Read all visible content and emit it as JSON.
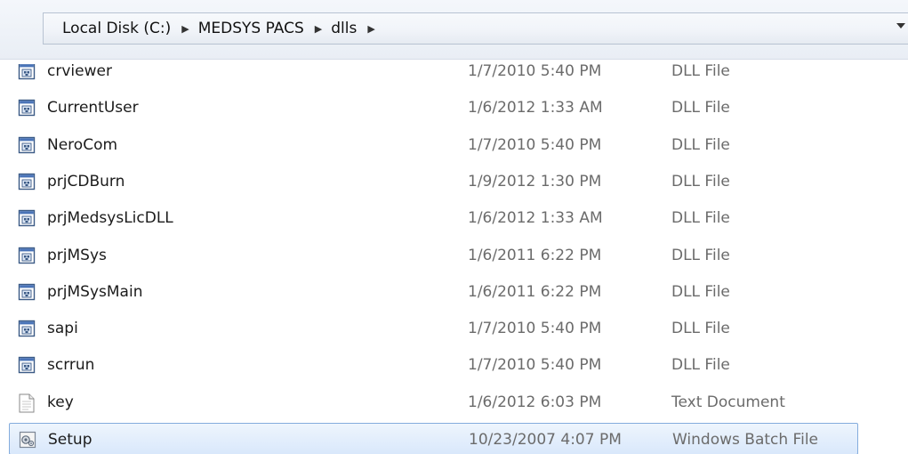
{
  "breadcrumb": {
    "items": [
      "Local Disk (C:)",
      "MEDSYS PACS",
      "dlls"
    ]
  },
  "files": [
    {
      "name": "crviewer",
      "date": "1/7/2010 5:40 PM",
      "type": "DLL File",
      "icon": "dll-file-icon",
      "partial": true
    },
    {
      "name": "CurrentUser",
      "date": "1/6/2012 1:33 AM",
      "type": "DLL File",
      "icon": "dll-file-icon"
    },
    {
      "name": "NeroCom",
      "date": "1/7/2010 5:40 PM",
      "type": "DLL File",
      "icon": "dll-file-icon"
    },
    {
      "name": "prjCDBurn",
      "date": "1/9/2012 1:30 PM",
      "type": "DLL File",
      "icon": "dll-file-icon"
    },
    {
      "name": "prjMedsysLicDLL",
      "date": "1/6/2012 1:33 AM",
      "type": "DLL File",
      "icon": "dll-file-icon"
    },
    {
      "name": "prjMSys",
      "date": "1/6/2011 6:22 PM",
      "type": "DLL File",
      "icon": "dll-file-icon"
    },
    {
      "name": "prjMSysMain",
      "date": "1/6/2011 6:22 PM",
      "type": "DLL File",
      "icon": "dll-file-icon"
    },
    {
      "name": "sapi",
      "date": "1/7/2010 5:40 PM",
      "type": "DLL File",
      "icon": "dll-file-icon"
    },
    {
      "name": "scrrun",
      "date": "1/7/2010 5:40 PM",
      "type": "DLL File",
      "icon": "dll-file-icon"
    },
    {
      "name": "key",
      "date": "1/6/2012 6:03 PM",
      "type": "Text Document",
      "icon": "text-file-icon"
    },
    {
      "name": "Setup",
      "date": "10/23/2007 4:07 PM",
      "type": "Windows Batch File",
      "icon": "batch-file-icon",
      "selected": true
    }
  ]
}
